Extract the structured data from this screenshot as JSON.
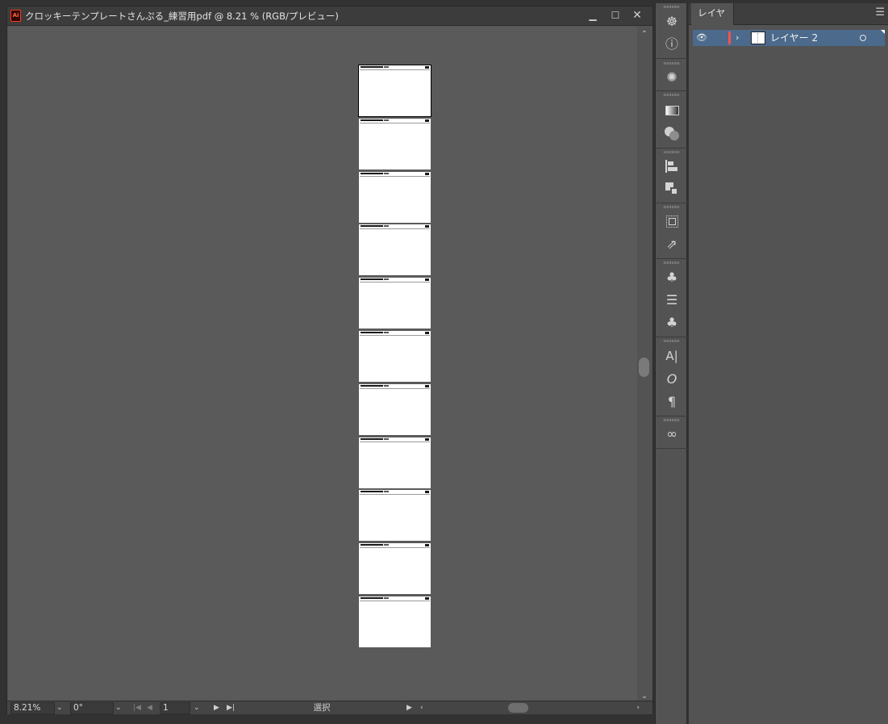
{
  "document": {
    "title": "クロッキーテンプレートさんぷる_練習用pdf @ 8.21 % (RGB/プレビュー)",
    "app_logo_text": "Ai",
    "window_controls": {
      "minimize": "▁",
      "maximize": "☐",
      "close": "✕"
    },
    "artboard_count": 11,
    "selected_artboard": 1
  },
  "status_bar": {
    "zoom": "8.21%",
    "rotation": "0°",
    "artboard_number": "1",
    "tool_status": "選択"
  },
  "layers_panel": {
    "tab_label": "レイヤー",
    "layers": [
      {
        "name": "レイヤー 2",
        "color": "#ff4f4f",
        "visible": true,
        "selected": true
      }
    ]
  },
  "dock_icons": [
    "navigator-icon",
    "info-icon",
    "appearance-icon",
    "gradient-icon",
    "transparency-icon",
    "align-icon",
    "pathfinder-icon",
    "transform-icon",
    "export-icon",
    "symbols-icon",
    "stroke-icon",
    "brushes-icon",
    "character-icon",
    "opentype-icon",
    "paragraph-icon",
    "links-icon"
  ],
  "colors": {
    "canvas": "#5a5a5a",
    "selection_row": "#4b6a8c",
    "layer_color": "#ff4f4f",
    "app_accent": "#ff3a1f"
  }
}
